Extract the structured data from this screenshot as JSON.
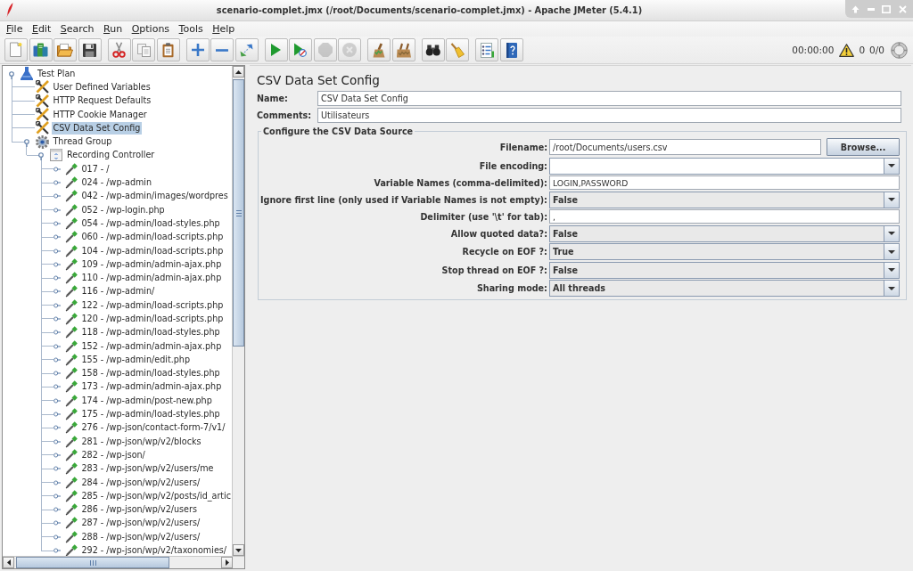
{
  "window": {
    "title": "scenario-complet.jmx (/root/Documents/scenario-complet.jmx) - Apache JMeter (5.4.1)"
  },
  "menu": [
    "File",
    "Edit",
    "Search",
    "Run",
    "Options",
    "Tools",
    "Help"
  ],
  "toolbar": {
    "groups": [
      {
        "buttons": [
          {
            "kind": "new",
            "disabled": false
          },
          {
            "kind": "templates",
            "disabled": false
          },
          {
            "kind": "open",
            "disabled": false
          },
          {
            "kind": "save",
            "disabled": false
          }
        ]
      },
      {
        "buttons": [
          {
            "kind": "cut",
            "disabled": false
          },
          {
            "kind": "copy",
            "disabled": false
          },
          {
            "kind": "paste",
            "disabled": false
          }
        ]
      },
      {
        "buttons": [
          {
            "kind": "expand",
            "disabled": false
          },
          {
            "kind": "collapse",
            "disabled": false
          },
          {
            "kind": "toggle",
            "disabled": false
          }
        ]
      },
      {
        "buttons": [
          {
            "kind": "start",
            "disabled": false
          },
          {
            "kind": "nopause",
            "disabled": false
          },
          {
            "kind": "stop",
            "disabled": true
          },
          {
            "kind": "shutdown",
            "disabled": true
          }
        ]
      },
      {
        "buttons": [
          {
            "kind": "clear",
            "disabled": false
          },
          {
            "kind": "clearall",
            "disabled": false
          }
        ]
      },
      {
        "buttons": [
          {
            "kind": "search",
            "disabled": false
          },
          {
            "kind": "reset",
            "disabled": false
          }
        ]
      },
      {
        "buttons": [
          {
            "kind": "functions",
            "disabled": false
          },
          {
            "kind": "help",
            "disabled": false
          }
        ]
      }
    ],
    "timer": "00:00:00",
    "warnings": "0",
    "threads": "0/0"
  },
  "tree": {
    "items": [
      {
        "label": "Test Plan",
        "kind": "plan",
        "selected": false,
        "expanded": true,
        "children": [
          {
            "label": "User Defined Variables",
            "kind": "config",
            "selected": false
          },
          {
            "label": "HTTP Request Defaults",
            "kind": "config",
            "selected": false
          },
          {
            "label": "HTTP Cookie Manager",
            "kind": "config",
            "selected": false
          },
          {
            "label": "CSV Data Set Config",
            "kind": "config",
            "selected": true
          },
          {
            "label": "Thread Group",
            "kind": "threads",
            "selected": false,
            "expanded": true,
            "children": [
              {
                "label": "Recording Controller",
                "kind": "controller",
                "selected": false,
                "expanded": true,
                "children": [
                  {
                    "label": "017 - /",
                    "kind": "sampler",
                    "selected": false,
                    "expanded": false
                  },
                  {
                    "label": "024 - /wp-admin",
                    "kind": "sampler",
                    "selected": false,
                    "expanded": false
                  },
                  {
                    "label": "042 - /wp-admin/images/wordpres",
                    "kind": "sampler",
                    "selected": false,
                    "expanded": false
                  },
                  {
                    "label": "052 - /wp-login.php",
                    "kind": "sampler",
                    "selected": false,
                    "expanded": false
                  },
                  {
                    "label": "054 - /wp-admin/load-styles.php",
                    "kind": "sampler",
                    "selected": false,
                    "expanded": false
                  },
                  {
                    "label": "060 - /wp-admin/load-scripts.php",
                    "kind": "sampler",
                    "selected": false,
                    "expanded": false
                  },
                  {
                    "label": "104 - /wp-admin/load-scripts.php",
                    "kind": "sampler",
                    "selected": false,
                    "expanded": false
                  },
                  {
                    "label": "109 - /wp-admin/admin-ajax.php",
                    "kind": "sampler",
                    "selected": false,
                    "expanded": false
                  },
                  {
                    "label": "110 - /wp-admin/admin-ajax.php",
                    "kind": "sampler",
                    "selected": false,
                    "expanded": false
                  },
                  {
                    "label": "116 - /wp-admin/",
                    "kind": "sampler",
                    "selected": false,
                    "expanded": false
                  },
                  {
                    "label": "122 - /wp-admin/load-scripts.php",
                    "kind": "sampler",
                    "selected": false,
                    "expanded": false
                  },
                  {
                    "label": "120 - /wp-admin/load-scripts.php",
                    "kind": "sampler",
                    "selected": false,
                    "expanded": false
                  },
                  {
                    "label": "118 - /wp-admin/load-styles.php",
                    "kind": "sampler",
                    "selected": false,
                    "expanded": false
                  },
                  {
                    "label": "152 - /wp-admin/admin-ajax.php",
                    "kind": "sampler",
                    "selected": false,
                    "expanded": false
                  },
                  {
                    "label": "155 - /wp-admin/edit.php",
                    "kind": "sampler",
                    "selected": false,
                    "expanded": false
                  },
                  {
                    "label": "158 - /wp-admin/load-styles.php",
                    "kind": "sampler",
                    "selected": false,
                    "expanded": false
                  },
                  {
                    "label": "173 - /wp-admin/admin-ajax.php",
                    "kind": "sampler",
                    "selected": false,
                    "expanded": false
                  },
                  {
                    "label": "174 - /wp-admin/post-new.php",
                    "kind": "sampler",
                    "selected": false,
                    "expanded": false
                  },
                  {
                    "label": "175 - /wp-admin/load-styles.php",
                    "kind": "sampler",
                    "selected": false,
                    "expanded": false
                  },
                  {
                    "label": "276 - /wp-json/contact-form-7/v1/",
                    "kind": "sampler",
                    "selected": false,
                    "expanded": false
                  },
                  {
                    "label": "281 - /wp-json/wp/v2/blocks",
                    "kind": "sampler",
                    "selected": false,
                    "expanded": false
                  },
                  {
                    "label": "282 - /wp-json/",
                    "kind": "sampler",
                    "selected": false,
                    "expanded": false
                  },
                  {
                    "label": "283 - /wp-json/wp/v2/users/me",
                    "kind": "sampler",
                    "selected": false,
                    "expanded": false
                  },
                  {
                    "label": "284 - /wp-json/wp/v2/users/",
                    "kind": "sampler",
                    "selected": false,
                    "expanded": false
                  },
                  {
                    "label": "285 - /wp-json/wp/v2/posts/id_artic",
                    "kind": "sampler",
                    "selected": false,
                    "expanded": false
                  },
                  {
                    "label": "286 - /wp-json/wp/v2/users",
                    "kind": "sampler",
                    "selected": false,
                    "expanded": false
                  },
                  {
                    "label": "287 - /wp-json/wp/v2/users/",
                    "kind": "sampler",
                    "selected": false,
                    "expanded": false
                  },
                  {
                    "label": "288 - /wp-json/wp/v2/users/",
                    "kind": "sampler",
                    "selected": false,
                    "expanded": false
                  },
                  {
                    "label": "292 - /wp-json/wp/v2/taxonomies/",
                    "kind": "sampler",
                    "selected": false,
                    "expanded": false
                  }
                ]
              }
            ]
          }
        ]
      }
    ]
  },
  "panel": {
    "title": "CSV Data Set Config",
    "name": {
      "label": "Name:",
      "value": "CSV Data Set Config"
    },
    "comments": {
      "label": "Comments:",
      "value": "Utilisateurs"
    },
    "group": {
      "title": "Configure the CSV Data Source",
      "fields": [
        {
          "kind": "file",
          "label": "Filename:",
          "value": "/root/Documents/users.csv",
          "button": "Browse..."
        },
        {
          "kind": "editcombo",
          "label": "File encoding:"
        },
        {
          "kind": "text",
          "label": "Variable Names (comma-delimited):",
          "value": "LOGIN,PASSWORD"
        },
        {
          "kind": "combo",
          "label": "Ignore first line (only used if Variable Names is not empty):",
          "value": "False"
        },
        {
          "kind": "text",
          "label": "Delimiter (use '\\t' for tab):",
          "value": ","
        },
        {
          "kind": "combo",
          "label": "Allow quoted data?:",
          "value": "False"
        },
        {
          "kind": "combo",
          "label": "Recycle on EOF ?:",
          "value": "True"
        },
        {
          "kind": "combo",
          "label": "Stop thread on EOF ?:",
          "value": "False"
        },
        {
          "kind": "combo",
          "label": "Sharing mode:",
          "value": "All threads"
        }
      ]
    }
  }
}
